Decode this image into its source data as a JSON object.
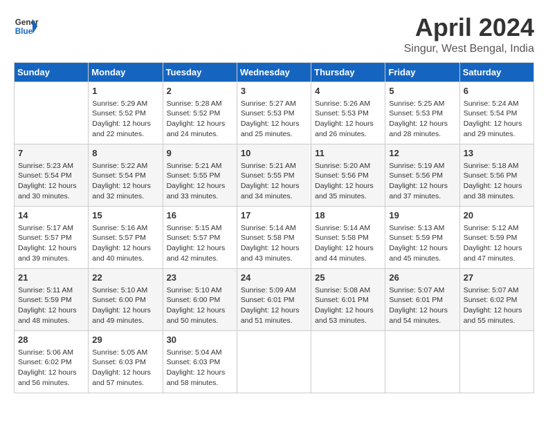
{
  "header": {
    "logo_general": "General",
    "logo_blue": "Blue",
    "month_title": "April 2024",
    "location": "Singur, West Bengal, India"
  },
  "days_of_week": [
    "Sunday",
    "Monday",
    "Tuesday",
    "Wednesday",
    "Thursday",
    "Friday",
    "Saturday"
  ],
  "weeks": [
    [
      {
        "day": "",
        "content": ""
      },
      {
        "day": "1",
        "content": "Sunrise: 5:29 AM\nSunset: 5:52 PM\nDaylight: 12 hours\nand 22 minutes."
      },
      {
        "day": "2",
        "content": "Sunrise: 5:28 AM\nSunset: 5:52 PM\nDaylight: 12 hours\nand 24 minutes."
      },
      {
        "day": "3",
        "content": "Sunrise: 5:27 AM\nSunset: 5:53 PM\nDaylight: 12 hours\nand 25 minutes."
      },
      {
        "day": "4",
        "content": "Sunrise: 5:26 AM\nSunset: 5:53 PM\nDaylight: 12 hours\nand 26 minutes."
      },
      {
        "day": "5",
        "content": "Sunrise: 5:25 AM\nSunset: 5:53 PM\nDaylight: 12 hours\nand 28 minutes."
      },
      {
        "day": "6",
        "content": "Sunrise: 5:24 AM\nSunset: 5:54 PM\nDaylight: 12 hours\nand 29 minutes."
      }
    ],
    [
      {
        "day": "7",
        "content": "Sunrise: 5:23 AM\nSunset: 5:54 PM\nDaylight: 12 hours\nand 30 minutes."
      },
      {
        "day": "8",
        "content": "Sunrise: 5:22 AM\nSunset: 5:54 PM\nDaylight: 12 hours\nand 32 minutes."
      },
      {
        "day": "9",
        "content": "Sunrise: 5:21 AM\nSunset: 5:55 PM\nDaylight: 12 hours\nand 33 minutes."
      },
      {
        "day": "10",
        "content": "Sunrise: 5:21 AM\nSunset: 5:55 PM\nDaylight: 12 hours\nand 34 minutes."
      },
      {
        "day": "11",
        "content": "Sunrise: 5:20 AM\nSunset: 5:56 PM\nDaylight: 12 hours\nand 35 minutes."
      },
      {
        "day": "12",
        "content": "Sunrise: 5:19 AM\nSunset: 5:56 PM\nDaylight: 12 hours\nand 37 minutes."
      },
      {
        "day": "13",
        "content": "Sunrise: 5:18 AM\nSunset: 5:56 PM\nDaylight: 12 hours\nand 38 minutes."
      }
    ],
    [
      {
        "day": "14",
        "content": "Sunrise: 5:17 AM\nSunset: 5:57 PM\nDaylight: 12 hours\nand 39 minutes."
      },
      {
        "day": "15",
        "content": "Sunrise: 5:16 AM\nSunset: 5:57 PM\nDaylight: 12 hours\nand 40 minutes."
      },
      {
        "day": "16",
        "content": "Sunrise: 5:15 AM\nSunset: 5:57 PM\nDaylight: 12 hours\nand 42 minutes."
      },
      {
        "day": "17",
        "content": "Sunrise: 5:14 AM\nSunset: 5:58 PM\nDaylight: 12 hours\nand 43 minutes."
      },
      {
        "day": "18",
        "content": "Sunrise: 5:14 AM\nSunset: 5:58 PM\nDaylight: 12 hours\nand 44 minutes."
      },
      {
        "day": "19",
        "content": "Sunrise: 5:13 AM\nSunset: 5:59 PM\nDaylight: 12 hours\nand 45 minutes."
      },
      {
        "day": "20",
        "content": "Sunrise: 5:12 AM\nSunset: 5:59 PM\nDaylight: 12 hours\nand 47 minutes."
      }
    ],
    [
      {
        "day": "21",
        "content": "Sunrise: 5:11 AM\nSunset: 5:59 PM\nDaylight: 12 hours\nand 48 minutes."
      },
      {
        "day": "22",
        "content": "Sunrise: 5:10 AM\nSunset: 6:00 PM\nDaylight: 12 hours\nand 49 minutes."
      },
      {
        "day": "23",
        "content": "Sunrise: 5:10 AM\nSunset: 6:00 PM\nDaylight: 12 hours\nand 50 minutes."
      },
      {
        "day": "24",
        "content": "Sunrise: 5:09 AM\nSunset: 6:01 PM\nDaylight: 12 hours\nand 51 minutes."
      },
      {
        "day": "25",
        "content": "Sunrise: 5:08 AM\nSunset: 6:01 PM\nDaylight: 12 hours\nand 53 minutes."
      },
      {
        "day": "26",
        "content": "Sunrise: 5:07 AM\nSunset: 6:01 PM\nDaylight: 12 hours\nand 54 minutes."
      },
      {
        "day": "27",
        "content": "Sunrise: 5:07 AM\nSunset: 6:02 PM\nDaylight: 12 hours\nand 55 minutes."
      }
    ],
    [
      {
        "day": "28",
        "content": "Sunrise: 5:06 AM\nSunset: 6:02 PM\nDaylight: 12 hours\nand 56 minutes."
      },
      {
        "day": "29",
        "content": "Sunrise: 5:05 AM\nSunset: 6:03 PM\nDaylight: 12 hours\nand 57 minutes."
      },
      {
        "day": "30",
        "content": "Sunrise: 5:04 AM\nSunset: 6:03 PM\nDaylight: 12 hours\nand 58 minutes."
      },
      {
        "day": "",
        "content": ""
      },
      {
        "day": "",
        "content": ""
      },
      {
        "day": "",
        "content": ""
      },
      {
        "day": "",
        "content": ""
      }
    ]
  ]
}
